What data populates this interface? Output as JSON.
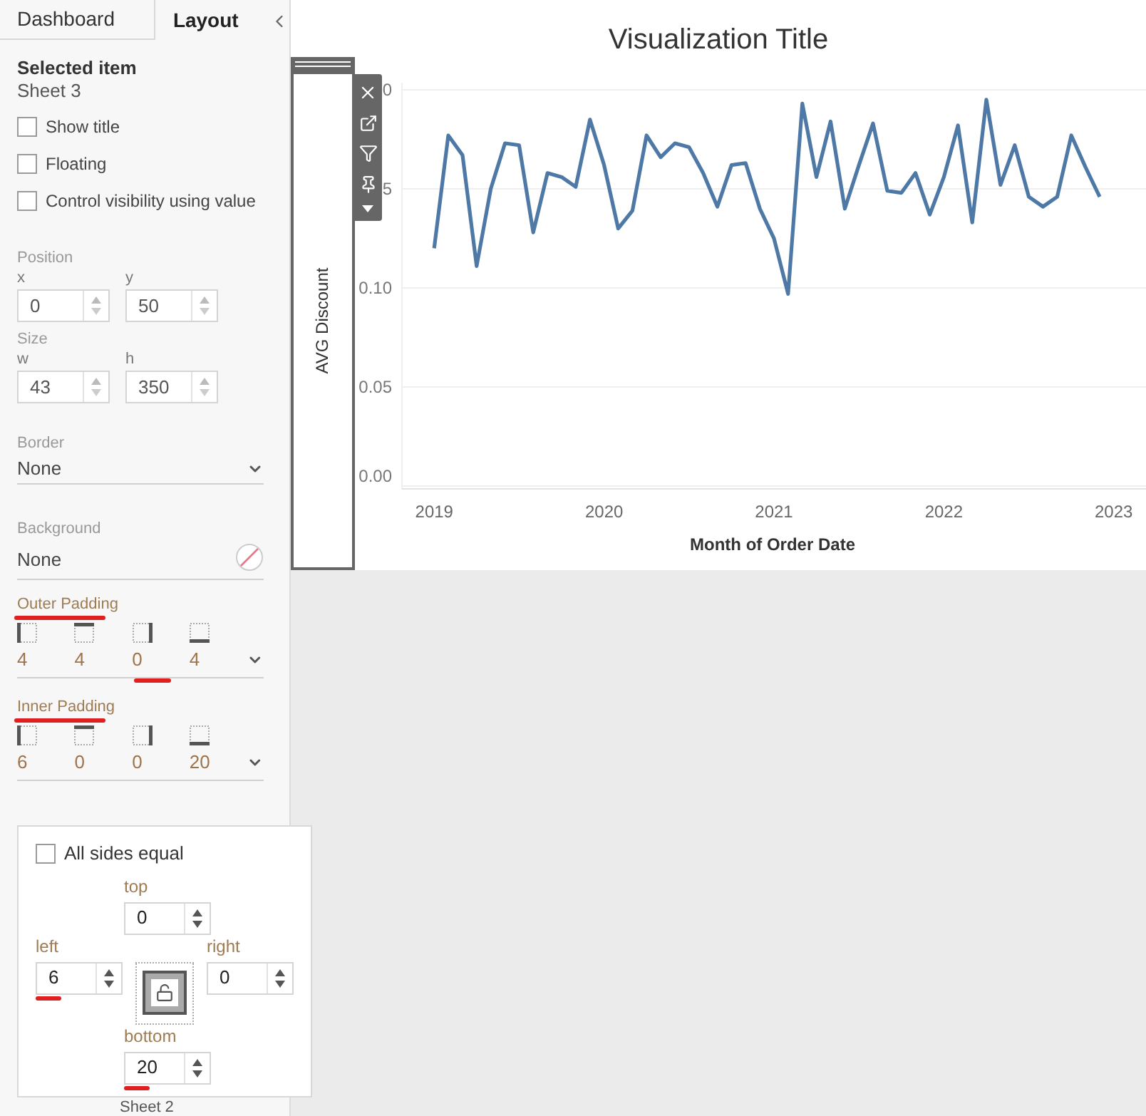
{
  "tabs": [
    {
      "label": "Dashboard",
      "selected": false
    },
    {
      "label": "Layout",
      "selected": true
    }
  ],
  "selected_item": {
    "heading": "Selected item",
    "name": "Sheet 3"
  },
  "options": [
    {
      "label": "Show title",
      "checked": false
    },
    {
      "label": "Floating",
      "checked": false
    },
    {
      "label": "Control visibility using value",
      "checked": false
    }
  ],
  "position": {
    "label": "Position",
    "fields": [
      {
        "label": "x",
        "value": "0"
      },
      {
        "label": "y",
        "value": "50"
      }
    ]
  },
  "size": {
    "label": "Size",
    "fields": [
      {
        "label": "w",
        "value": "43"
      },
      {
        "label": "h",
        "value": "350"
      }
    ]
  },
  "border": {
    "label": "Border",
    "value": "None"
  },
  "background": {
    "label": "Background",
    "value": "None"
  },
  "outer_padding": {
    "label": "Outer Padding",
    "underlined": true,
    "sides": [
      {
        "kind": "left",
        "value": "4",
        "underlined": false
      },
      {
        "kind": "top",
        "value": "4",
        "underlined": false
      },
      {
        "kind": "right",
        "value": "0",
        "underlined": true
      },
      {
        "kind": "bottom",
        "value": "4",
        "underlined": false
      }
    ]
  },
  "inner_padding": {
    "label": "Inner Padding",
    "underlined": true,
    "sides": [
      {
        "kind": "left",
        "value": "6",
        "underlined": false
      },
      {
        "kind": "top",
        "value": "0",
        "underlined": false
      },
      {
        "kind": "right",
        "value": "0",
        "underlined": false
      },
      {
        "kind": "bottom",
        "value": "20",
        "underlined": false
      }
    ]
  },
  "padding_popup": {
    "all_sides_equal": {
      "label": "All sides equal",
      "checked": false
    },
    "top": {
      "label": "top",
      "value": "0",
      "underlined": false
    },
    "left": {
      "label": "left",
      "value": "6",
      "underlined": true
    },
    "right": {
      "label": "right",
      "value": "0",
      "underlined": false
    },
    "bottom": {
      "label": "bottom",
      "value": "20",
      "underlined": true
    }
  },
  "sheet_tab": "Sheet 2",
  "chart": {
    "title": "Visualization Title",
    "partly_covered_tick_labels": [
      "0",
      "5"
    ],
    "chart_data": {
      "type": "line",
      "grid": true,
      "xlabel": "Month of Order Date",
      "ylabel": "AVG Discount",
      "xlim": [
        2018.81,
        2023.19
      ],
      "ylim": [
        0,
        0.2
      ],
      "x": [
        2019,
        2019.083,
        2019.167,
        2019.25,
        2019.333,
        2019.417,
        2019.5,
        2019.583,
        2019.667,
        2019.75,
        2019.833,
        2019.917,
        2020,
        2020.083,
        2020.167,
        2020.25,
        2020.333,
        2020.417,
        2020.5,
        2020.583,
        2020.667,
        2020.75,
        2020.833,
        2020.917,
        2021,
        2021.083,
        2021.167,
        2021.25,
        2021.333,
        2021.417,
        2021.5,
        2021.583,
        2021.667,
        2021.75,
        2021.833,
        2021.917,
        2022,
        2022.083,
        2022.167,
        2022.25,
        2022.333,
        2022.417,
        2022.5,
        2022.583,
        2022.667,
        2022.75,
        2022.833,
        2022.917
      ],
      "series": [
        {
          "color": "#4e79a7",
          "values": [
            0.12,
            0.177,
            0.167,
            0.111,
            0.15,
            0.173,
            0.172,
            0.128,
            0.158,
            0.156,
            0.151,
            0.185,
            0.162,
            0.13,
            0.139,
            0.177,
            0.166,
            0.173,
            0.171,
            0.158,
            0.141,
            0.162,
            0.163,
            0.14,
            0.125,
            0.097,
            0.193,
            0.156,
            0.184,
            0.14,
            0.162,
            0.183,
            0.149,
            0.148,
            0.158,
            0.137,
            0.156,
            0.182,
            0.133,
            0.195,
            0.152,
            0.172,
            0.146,
            0.141,
            0.146,
            0.177,
            0.161,
            0.146
          ]
        }
      ],
      "xticks": [
        2019,
        2020,
        2021,
        2022,
        2023
      ],
      "yticks": [
        {
          "value": 0,
          "label": "0.00"
        },
        {
          "value": 0.05,
          "label": "0.05"
        },
        {
          "value": 0.1,
          "label": "0.10"
        }
      ]
    }
  }
}
